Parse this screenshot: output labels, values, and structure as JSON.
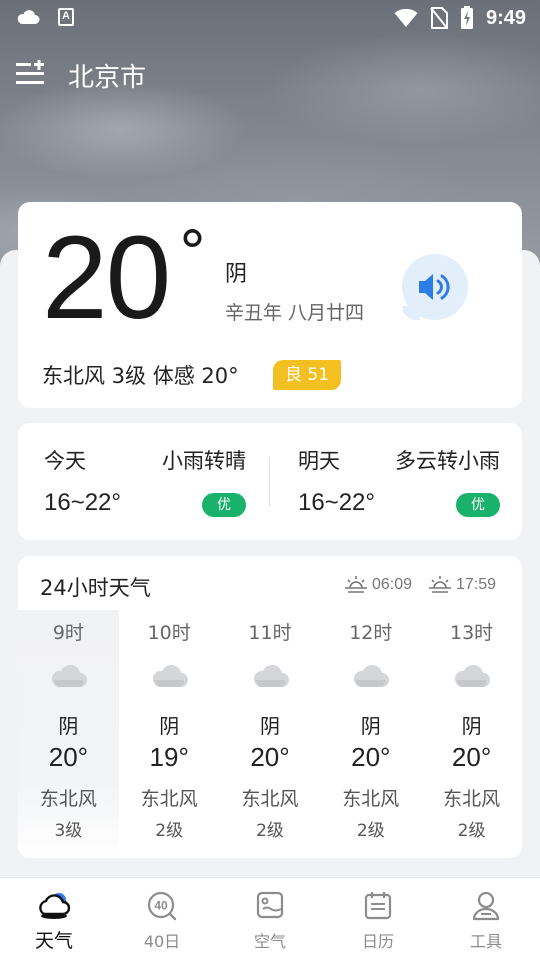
{
  "status_bar": {
    "time": "9:49",
    "notif_letter": "A"
  },
  "header": {
    "city": "北京市"
  },
  "current": {
    "temperature": "20",
    "degree_symbol": "°",
    "condition": "阴",
    "lunar_date": "辛丑年 八月廿四",
    "wind_feels": "东北风 3级  体感 20°",
    "aqi_label": "良 51",
    "aqi_color": "#f4c021"
  },
  "forecast": [
    {
      "day": "今天",
      "condition": "小雨转晴",
      "range": "16~22°",
      "aqi": "优"
    },
    {
      "day": "明天",
      "condition": "多云转小雨",
      "range": "16~22°",
      "aqi": "优"
    }
  ],
  "hourly": {
    "title": "24小时天气",
    "sunrise": "06:09",
    "sunset": "17:59",
    "hours": [
      {
        "time": "9时",
        "condition": "阴",
        "temp": "20°",
        "wind": "东北风",
        "level": "3级",
        "icon": "cloud-icon"
      },
      {
        "time": "10时",
        "condition": "阴",
        "temp": "19°",
        "wind": "东北风",
        "level": "2级",
        "icon": "cloud-icon"
      },
      {
        "time": "11时",
        "condition": "阴",
        "temp": "20°",
        "wind": "东北风",
        "level": "2级",
        "icon": "cloud-icon"
      },
      {
        "time": "12时",
        "condition": "阴",
        "temp": "20°",
        "wind": "东北风",
        "level": "2级",
        "icon": "cloud-icon"
      },
      {
        "time": "13时",
        "condition": "阴",
        "temp": "20°",
        "wind": "东北风",
        "level": "2级",
        "icon": "cloud-icon"
      }
    ]
  },
  "nav": [
    {
      "label": "天气",
      "icon": "weather-icon",
      "active": true
    },
    {
      "label": "40日",
      "icon": "40-day-icon",
      "active": false,
      "icon_text": "40"
    },
    {
      "label": "空气",
      "icon": "air-icon",
      "active": false
    },
    {
      "label": "日历",
      "icon": "calendar-icon",
      "active": false
    },
    {
      "label": "工具",
      "icon": "tools-icon",
      "active": false
    }
  ],
  "colors": {
    "accent_blue": "#2b7de9",
    "aqi_good_green": "#19b26b"
  }
}
